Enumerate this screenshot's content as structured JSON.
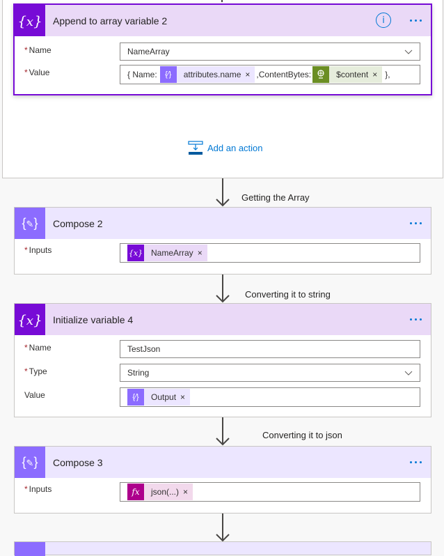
{
  "colors": {
    "variable_dark": "#770bd6",
    "variable_header_bg": "#ead9f7",
    "compose_icon": "#8c6cff",
    "compose_header_bg": "#ece6ff",
    "dynamic_token_bg": "#ece6ff",
    "var_token_bg": "#ead9f7",
    "content_icon": "#6b8e23",
    "content_token_bg": "#e6eddc",
    "fx_icon": "#ad008c",
    "fx_token_bg": "#f2d9ec",
    "link": "#0078d4",
    "required": "#a4262c"
  },
  "append_card": {
    "title": "Append to array variable 2",
    "icon": "variable-icon",
    "name_label": "Name",
    "name_value": "NameArray",
    "value_label": "Value",
    "value_prefix": "{ Name:",
    "token1": {
      "icon": "dynamic-content-icon",
      "text": "attributes.name",
      "remove": "×"
    },
    "value_middle": ",ContentBytes:",
    "token2": {
      "icon": "content-globe-icon",
      "text": "$content",
      "remove": "×"
    },
    "value_suffix": "},"
  },
  "add_action": {
    "label": "Add an action",
    "icon": "add-action-icon"
  },
  "connectors": [
    {
      "caption": "Getting the Array"
    },
    {
      "caption": "Converting it to string"
    },
    {
      "caption": "Converting it to json"
    },
    {
      "caption": ""
    }
  ],
  "compose2_card": {
    "title": "Compose 2",
    "icon": "compose-icon",
    "inputs_label": "Inputs",
    "token": {
      "icon": "variable-icon",
      "text": "NameArray",
      "remove": "×"
    }
  },
  "init_card": {
    "title": "Initialize variable 4",
    "icon": "variable-icon",
    "name_label": "Name",
    "name_value": "TestJson",
    "type_label": "Type",
    "type_value": "String",
    "value_label": "Value",
    "token": {
      "icon": "dynamic-content-icon",
      "text": "Output",
      "remove": "×"
    }
  },
  "compose3_card": {
    "title": "Compose 3",
    "icon": "compose-icon",
    "inputs_label": "Inputs",
    "token": {
      "icon": "fx-icon",
      "text": "json(...)",
      "remove": "×",
      "glyph": "fx"
    }
  },
  "required_mark": "*"
}
